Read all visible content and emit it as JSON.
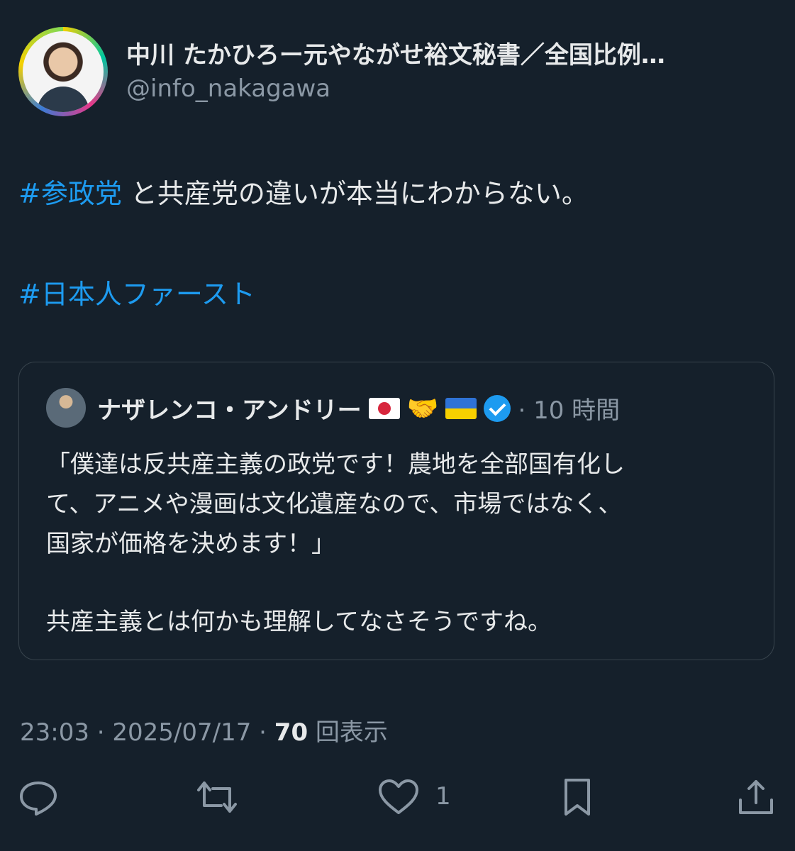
{
  "author": {
    "display_name": "中川 たかひろー元やながせ裕文秘書／全国比例…",
    "handle": "@info_nakagawa"
  },
  "tweet": {
    "line1_hashtag": "#参政党",
    "line1_text": " と共産党の違いが本当にわからない。",
    "line2_hashtag": "#日本人ファースト"
  },
  "quote": {
    "name": "ナザレンコ・アンドリー",
    "time": "· 10 時間",
    "lines": [
      "「僕達は反共産主義の政党です！農地を全部国有化し",
      "て、アニメや漫画は文化遺産なので、市場ではなく、",
      "国家が価格を決めます！」",
      "共産主義とは何かも理解してなさそうですね。"
    ]
  },
  "meta": {
    "time": "23:03 · 2025/07/17 · ",
    "views_count": "70",
    "views_label": " 回表示"
  },
  "actions": {
    "like_count": "1",
    "icons": [
      "reply-icon",
      "retweet-icon",
      "like-icon",
      "bookmark-icon",
      "share-icon"
    ]
  },
  "colors": {
    "background": "#15202b",
    "hashtag": "#1d9bf0",
    "muted": "#8b98a5",
    "text": "#e7e9ea"
  }
}
